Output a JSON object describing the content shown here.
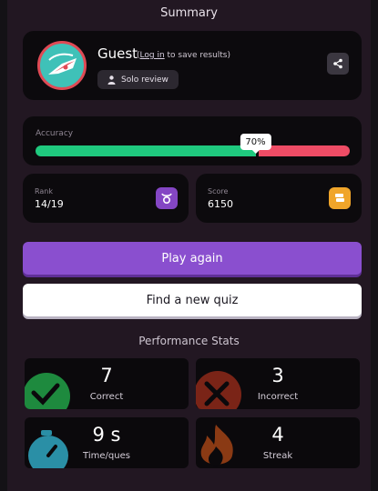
{
  "header": {
    "title": "Summary"
  },
  "profile": {
    "name": "Guest",
    "login_prefix": "(",
    "login_link": "Log in",
    "login_suffix": " to save results)",
    "mode_badge": "Solo review"
  },
  "accuracy": {
    "label": "Accuracy",
    "percent_text": "70%",
    "percent": 70
  },
  "rank": {
    "label": "Rank",
    "value": "14/19"
  },
  "score": {
    "label": "Score",
    "value": "6150"
  },
  "actions": {
    "play_again": "Play again",
    "find_quiz": "Find a new quiz"
  },
  "performance": {
    "title": "Performance Stats",
    "stats": [
      {
        "value": "7",
        "label": "Correct",
        "icon": "check-icon",
        "color": "#1e8a3e"
      },
      {
        "value": "3",
        "label": "Incorrect",
        "icon": "x-icon",
        "color": "#c0392b"
      },
      {
        "value": "9 s",
        "label": "Time/ques",
        "icon": "stopwatch-icon",
        "color": "#2a8fa6"
      },
      {
        "value": "4",
        "label": "Streak",
        "icon": "flame-icon",
        "color": "#c05a1c"
      }
    ]
  },
  "colors": {
    "correct_bar": "#1fc97e",
    "incorrect_bar": "#ee4c65",
    "primary": "#8a4fcf"
  }
}
